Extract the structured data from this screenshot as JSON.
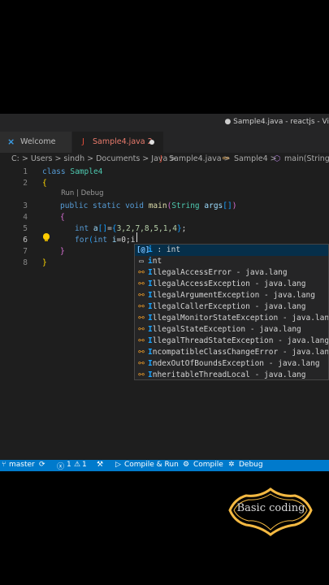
{
  "window": {
    "title": "● Sample4.java - reactjs - Vi"
  },
  "tabs": [
    {
      "label": "Welcome",
      "icon": "vscode-icon"
    },
    {
      "label": "Sample4.java 2",
      "icon": "java-file-icon",
      "modified": true
    }
  ],
  "breadcrumb": {
    "path": "C: > Users > sindh > Documents > Java >",
    "file": "Sample4.java >",
    "class": "Sample4 >",
    "method": "main(String[]"
  },
  "codelens": "Run | Debug",
  "code": {
    "line_numbers": [
      "1",
      "2",
      "3",
      "4",
      "5",
      "6",
      "7",
      "8"
    ],
    "l1_kw": "class",
    "l1_name": "Sample4",
    "l2": "{",
    "l3_kw": "public static void",
    "l3_fn": "main",
    "l3_open": "(",
    "l3_type": "String",
    "l3_arg": "args",
    "l3_arr": "[]",
    "l3_close": ")",
    "l4": "{",
    "l5_kw": "int",
    "l5_var": "a",
    "l5_br": "[]",
    "l5_eq": "=",
    "l5_open": "{",
    "l5_nums": "3,2,7,8,5,1,4",
    "l5_close": "}",
    "l5_end": ";",
    "l6_kw": "for",
    "l6_open": "(",
    "l6_kw2": "int",
    "l6_var": "i",
    "l6_rest": "=0;i",
    "l7": "}",
    "l8": "}"
  },
  "suggestions": [
    {
      "icon": "variable-icon",
      "match": "i",
      "rest": " : int"
    },
    {
      "icon": "keyword-icon",
      "match": "i",
      "rest": "nt"
    },
    {
      "icon": "class-icon",
      "match": "I",
      "rest": "llegalAccessError - java.lang"
    },
    {
      "icon": "class-icon",
      "match": "I",
      "rest": "llegalAccessException - java.lang"
    },
    {
      "icon": "class-icon",
      "match": "I",
      "rest": "llegalArgumentException - java.lang"
    },
    {
      "icon": "class-icon",
      "match": "I",
      "rest": "llegalCallerException - java.lang"
    },
    {
      "icon": "class-icon",
      "match": "I",
      "rest": "llegalMonitorStateException - java.lang"
    },
    {
      "icon": "class-icon",
      "match": "I",
      "rest": "llegalStateException - java.lang"
    },
    {
      "icon": "class-icon",
      "match": "I",
      "rest": "llegalThreadStateException - java.lang"
    },
    {
      "icon": "class-icon",
      "match": "I",
      "rest": "ncompatibleClassChangeError - java.lang"
    },
    {
      "icon": "class-icon",
      "match": "I",
      "rest": "ndexOutOfBoundsException - java.lang"
    },
    {
      "icon": "class-icon",
      "match": "I",
      "rest": "nheritableThreadLocal - java.lang"
    }
  ],
  "status": {
    "branch": "master",
    "errors": "1",
    "warnings": "1",
    "compile_run": "Compile & Run",
    "compile": "Compile",
    "debug": "Debug"
  },
  "logo_text": "Basic coding",
  "colors": {
    "accent": "#007acc",
    "editor_bg": "#1e1e1e",
    "page_bg": "#000000"
  }
}
